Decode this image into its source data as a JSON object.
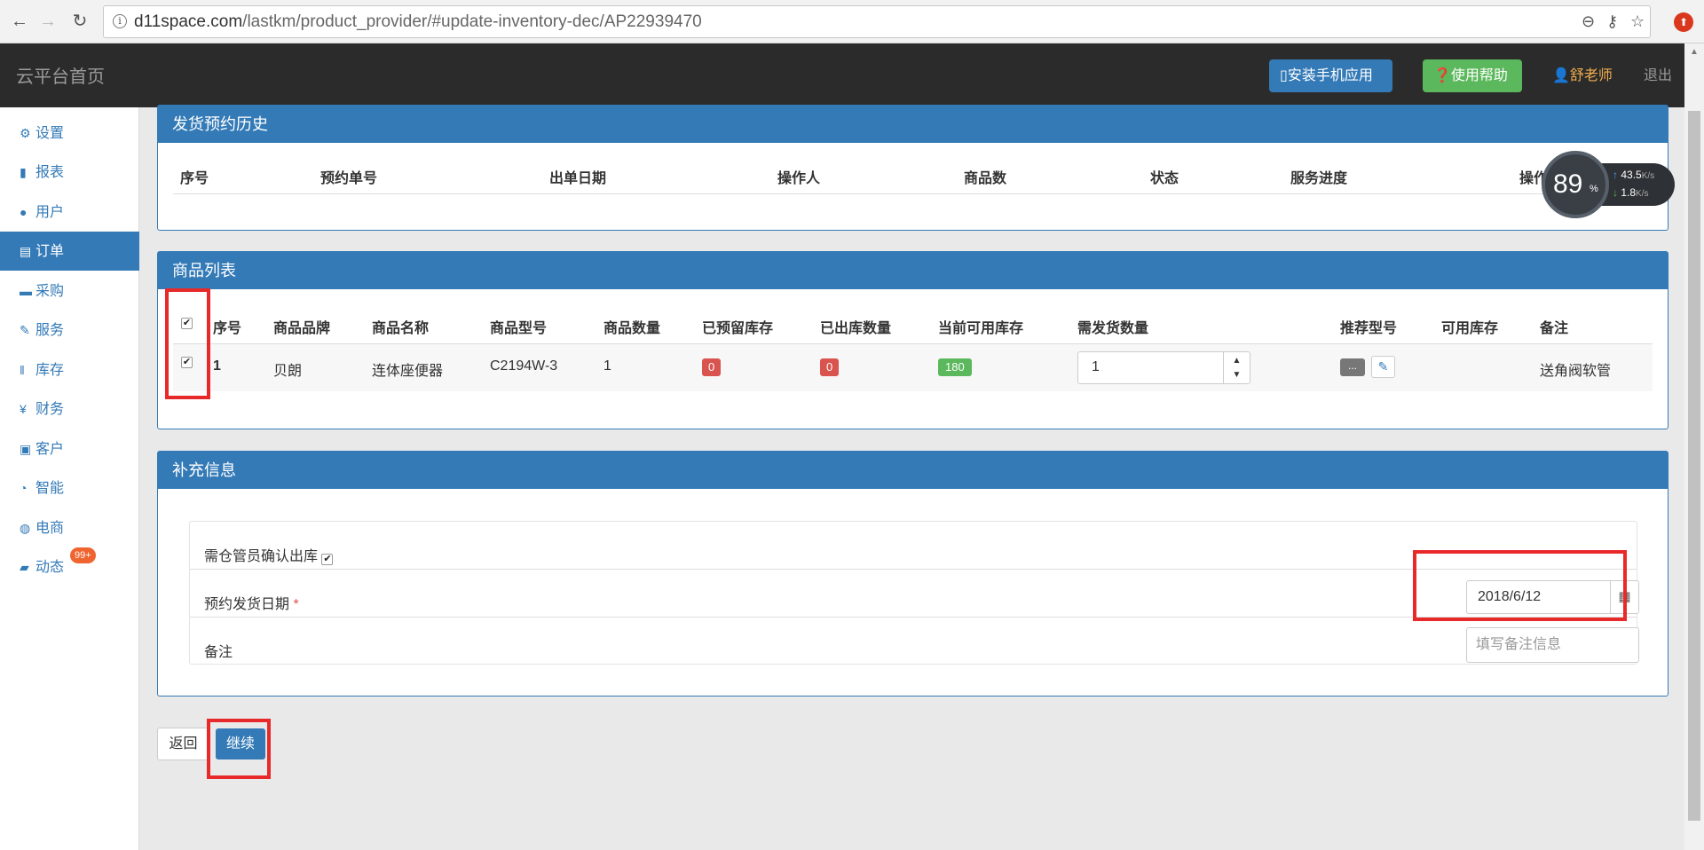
{
  "browser": {
    "url_host": "d11space.com",
    "url_path": "/lastkm/product_provider/#update-inventory-dec/AP22939470"
  },
  "topbar": {
    "brand": "云平台首页",
    "install_app": "安装手机应用",
    "help": "使用帮助",
    "user": "舒老师",
    "logout": "退出"
  },
  "sidebar": {
    "items": [
      {
        "label": "设置",
        "icon": "gear-icon"
      },
      {
        "label": "报表",
        "icon": "bar-chart-icon"
      },
      {
        "label": "用户",
        "icon": "user-icon"
      },
      {
        "label": "订单",
        "icon": "list-icon",
        "active": true
      },
      {
        "label": "采购",
        "icon": "cart-icon"
      },
      {
        "label": "服务",
        "icon": "wrench-icon"
      },
      {
        "label": "库存",
        "icon": "barcode-icon"
      },
      {
        "label": "财务",
        "icon": "yen-icon"
      },
      {
        "label": "客户",
        "icon": "briefcase-icon"
      },
      {
        "label": "智能",
        "icon": "dashboard-icon"
      },
      {
        "label": "电商",
        "icon": "globe-icon"
      },
      {
        "label": "动态",
        "icon": "comment-icon",
        "badge": "99+"
      }
    ]
  },
  "history": {
    "title": "发货预约历史",
    "columns": [
      "序号",
      "预约单号",
      "出单日期",
      "操作人",
      "商品数",
      "状态",
      "服务进度",
      "操作"
    ]
  },
  "products": {
    "title": "商品列表",
    "columns": [
      "序号",
      "商品品牌",
      "商品名称",
      "商品型号",
      "商品数量",
      "已预留库存",
      "已出库数量",
      "当前可用库存",
      "需发货数量",
      "推荐型号",
      "可用库存",
      "备注"
    ],
    "rows": [
      {
        "index": "1",
        "brand": "贝朗",
        "name": "连体座便器",
        "model": "C2194W-3",
        "qty": "1",
        "reserved": "0",
        "shipped": "0",
        "available": "180",
        "to_ship": "1",
        "recommend_btn": "...",
        "stock": "",
        "note": "送角阀软管"
      }
    ]
  },
  "extra": {
    "title": "补充信息",
    "confirm_label": "需仓管员确认出库",
    "date_label": "预约发货日期",
    "required_mark": "*",
    "date_value": "2018/6/12",
    "note_label": "备注",
    "note_placeholder": "填写备注信息"
  },
  "actions": {
    "back": "返回",
    "continue": "继续"
  },
  "speed_widget": {
    "percent": "89",
    "percent_sign": "%",
    "up": "43.5",
    "down": "1.8",
    "unit": "K/s"
  },
  "colors": {
    "primary": "#337ab7",
    "success": "#5cb85c",
    "danger": "#d9534f",
    "highlight": "#e8292a"
  }
}
